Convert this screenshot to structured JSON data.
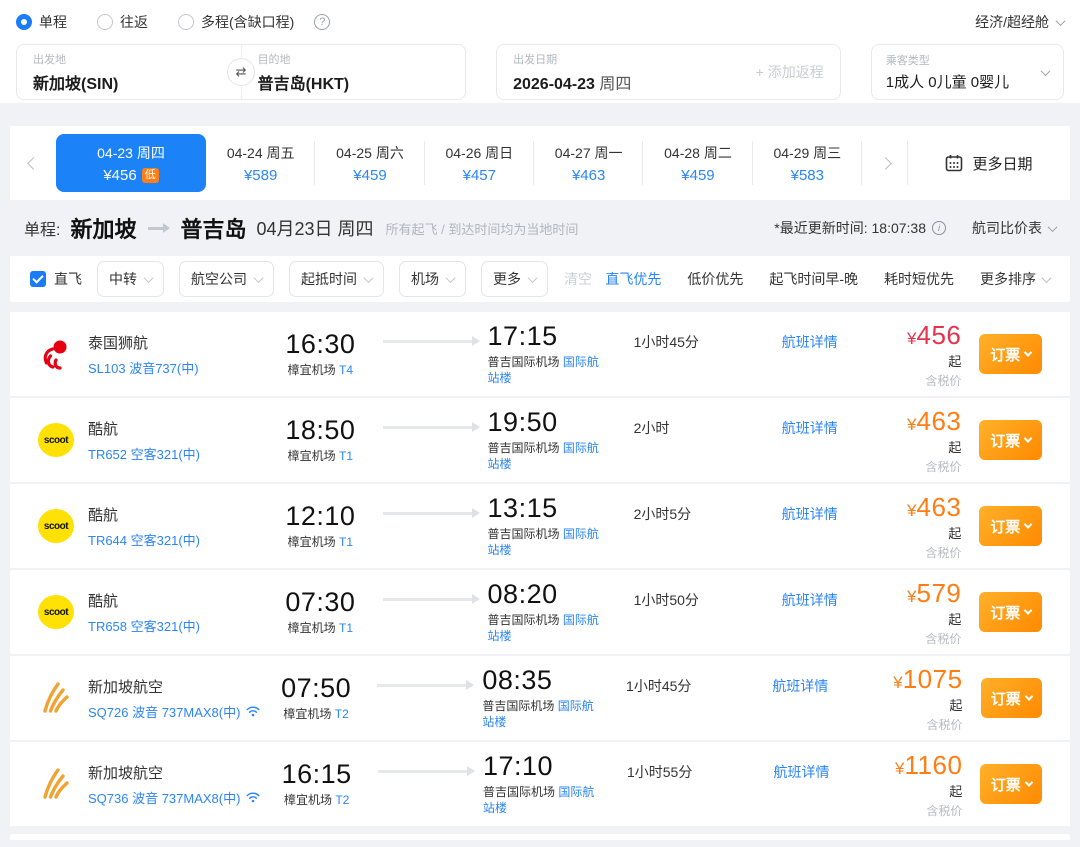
{
  "colors": {
    "accent_blue": "#1b82f8",
    "link_blue": "#2b85f8",
    "lowest_price_red": "#e5334d",
    "price_orange": "#ff7d13",
    "book_button_orange": "#ff8a00",
    "low_badge_orange": "#ff7e15"
  },
  "icons": {
    "swap": "⇄",
    "help": "?",
    "info": "i"
  },
  "labels": {
    "currency": "¥",
    "price_suffix": "起",
    "tax_note": "含税价",
    "details_link": "航班详情",
    "book": "订票"
  },
  "trip_type": {
    "options": [
      {
        "label": "单程",
        "selected": true
      },
      {
        "label": "往返",
        "selected": false
      },
      {
        "label": "多程(含缺口程)",
        "selected": false
      }
    ]
  },
  "cabin_selector": "经济/超经舱",
  "search": {
    "from_label": "出发地",
    "from_value": "新加坡(SIN)",
    "to_label": "目的地",
    "to_value": "普吉岛(HKT)",
    "date_label": "出发日期",
    "date_value": "2026-04-23",
    "date_week": "周四",
    "add_return": "+ 添加返程",
    "passenger_label": "乘客类型",
    "passenger_value": "1成人  0儿童  0婴儿"
  },
  "date_carousel": {
    "more_dates": "更多日期",
    "days": [
      {
        "date": "04-23 周四",
        "price": "¥456",
        "badge": "低",
        "selected": true
      },
      {
        "date": "04-24 周五",
        "price": "¥589",
        "selected": false
      },
      {
        "date": "04-25 周六",
        "price": "¥459",
        "selected": false
      },
      {
        "date": "04-26 周日",
        "price": "¥457",
        "selected": false
      },
      {
        "date": "04-27 周一",
        "price": "¥463",
        "selected": false
      },
      {
        "date": "04-28 周二",
        "price": "¥459",
        "selected": false
      },
      {
        "date": "04-29 周三",
        "price": "¥583",
        "selected": false
      }
    ]
  },
  "summary": {
    "trip_label": "单程:",
    "from": "新加坡",
    "to": "普吉岛",
    "date": "04月23日 周四",
    "note": "所有起飞 / 到达时间均为当地时间",
    "updated": "*最近更新时间: 18:07:38",
    "compare": "航司比价表"
  },
  "filters": {
    "direct_label": "直飞",
    "pills": [
      "中转",
      "航空公司",
      "起抵时间",
      "机场",
      "更多"
    ],
    "clear": "清空",
    "sorts": [
      {
        "label": "直飞优先",
        "active": true,
        "dropdown": false
      },
      {
        "label": "低价优先",
        "active": false,
        "dropdown": false
      },
      {
        "label": "起飞时间早-晚",
        "active": false,
        "dropdown": false
      },
      {
        "label": "耗时短优先",
        "active": false,
        "dropdown": false
      },
      {
        "label": "更多排序",
        "active": false,
        "dropdown": true
      }
    ]
  },
  "flights": [
    {
      "airline": "泰国狮航",
      "logo": "lion",
      "logo_text": "",
      "code": "SL103 波音737(中)",
      "wifi": false,
      "dep_time": "16:30",
      "dep_airport": "樟宜机场",
      "dep_terminal": "T4",
      "arr_time": "17:15",
      "arr_airport": "普吉国际机场",
      "arr_terminal": "国际航站楼",
      "duration": "1小时45分",
      "price": "456",
      "price_color": "red"
    },
    {
      "airline": "酷航",
      "logo": "scoot",
      "logo_text": "scoot",
      "code": "TR652 空客321(中)",
      "wifi": false,
      "dep_time": "18:50",
      "dep_airport": "樟宜机场",
      "dep_terminal": "T1",
      "arr_time": "19:50",
      "arr_airport": "普吉国际机场",
      "arr_terminal": "国际航站楼",
      "duration": "2小时",
      "price": "463",
      "price_color": "orange"
    },
    {
      "airline": "酷航",
      "logo": "scoot",
      "logo_text": "scoot",
      "code": "TR644 空客321(中)",
      "wifi": false,
      "dep_time": "12:10",
      "dep_airport": "樟宜机场",
      "dep_terminal": "T1",
      "arr_time": "13:15",
      "arr_airport": "普吉国际机场",
      "arr_terminal": "国际航站楼",
      "duration": "2小时5分",
      "price": "463",
      "price_color": "orange"
    },
    {
      "airline": "酷航",
      "logo": "scoot",
      "logo_text": "scoot",
      "code": "TR658 空客321(中)",
      "wifi": false,
      "dep_time": "07:30",
      "dep_airport": "樟宜机场",
      "dep_terminal": "T1",
      "arr_time": "08:20",
      "arr_airport": "普吉国际机场",
      "arr_terminal": "国际航站楼",
      "duration": "1小时50分",
      "price": "579",
      "price_color": "orange"
    },
    {
      "airline": "新加坡航空",
      "logo": "sq",
      "logo_text": "",
      "code": "SQ726 波音 737MAX8(中)",
      "wifi": true,
      "dep_time": "07:50",
      "dep_airport": "樟宜机场",
      "dep_terminal": "T2",
      "arr_time": "08:35",
      "arr_airport": "普吉国际机场",
      "arr_terminal": "国际航站楼",
      "duration": "1小时45分",
      "price": "1075",
      "price_color": "orange"
    },
    {
      "airline": "新加坡航空",
      "logo": "sq",
      "logo_text": "",
      "code": "SQ736 波音 737MAX8(中)",
      "wifi": true,
      "dep_time": "16:15",
      "dep_airport": "樟宜机场",
      "dep_terminal": "T2",
      "arr_time": "17:10",
      "arr_airport": "普吉国际机场",
      "arr_terminal": "国际航站楼",
      "duration": "1小时55分",
      "price": "1160",
      "price_color": "orange"
    }
  ]
}
